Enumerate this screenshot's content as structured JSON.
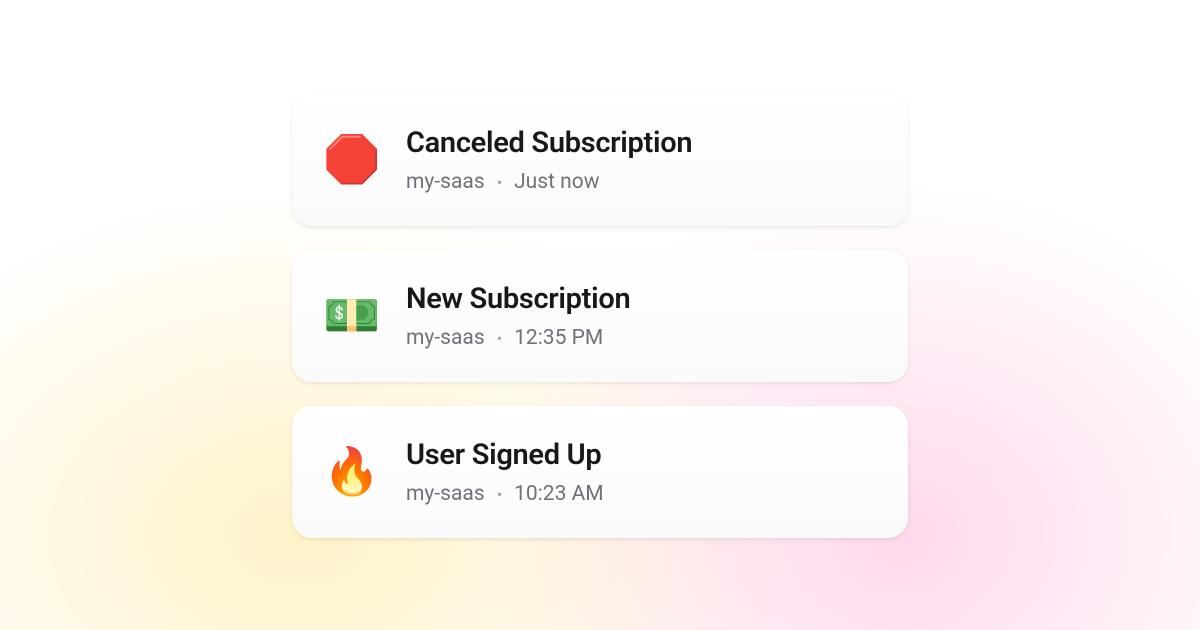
{
  "notifications": [
    {
      "icon": "🛑",
      "icon_name": "stop-sign-icon",
      "title": "Canceled Subscription",
      "project": "my-saas",
      "timestamp": "Just now"
    },
    {
      "icon": "💵",
      "icon_name": "money-icon",
      "title": "New Subscription",
      "project": "my-saas",
      "timestamp": "12:35 PM"
    },
    {
      "icon": "🔥",
      "icon_name": "fire-icon",
      "title": "User Signed Up",
      "project": "my-saas",
      "timestamp": "10:23 AM"
    }
  ],
  "separator": "•"
}
